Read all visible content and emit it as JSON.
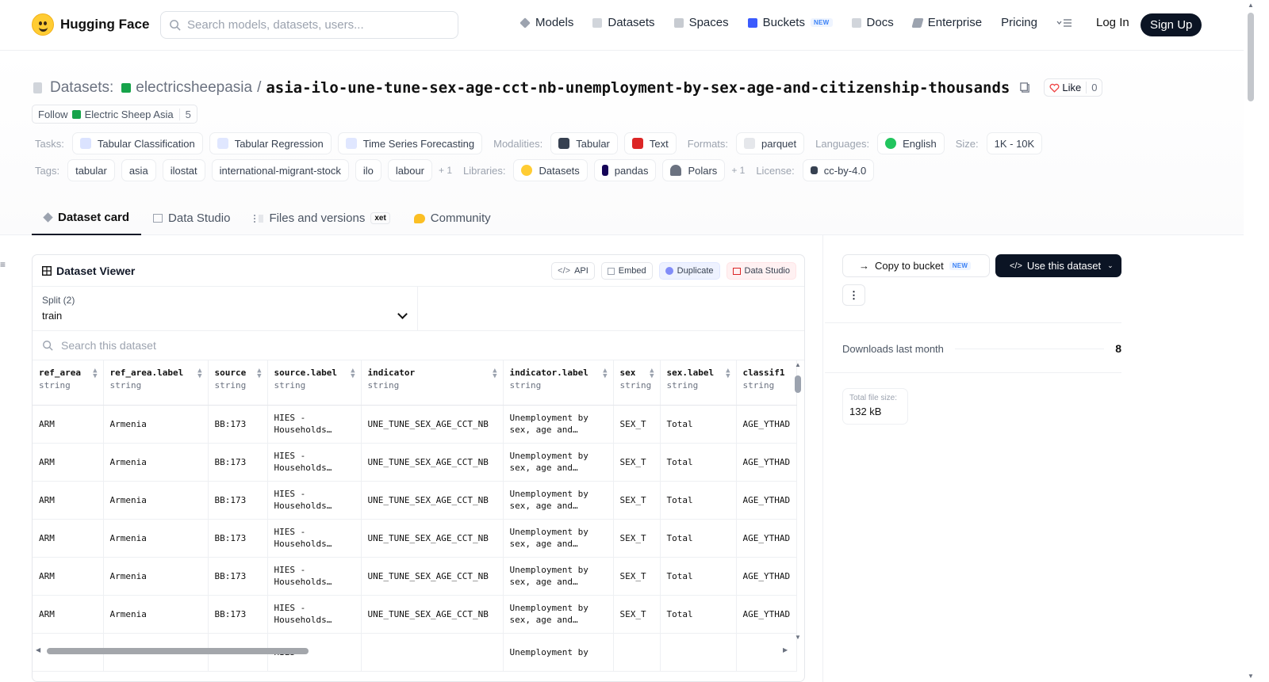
{
  "header": {
    "brand": "Hugging Face",
    "search_placeholder": "Search models, datasets, users...",
    "nav": [
      {
        "label": "Models",
        "icon": "cube-icon"
      },
      {
        "label": "Datasets",
        "icon": "database-icon"
      },
      {
        "label": "Spaces",
        "icon": "grid-icon"
      },
      {
        "label": "Buckets",
        "icon": "bucket-icon",
        "badge": "NEW"
      },
      {
        "label": "Docs",
        "icon": "book-icon"
      },
      {
        "label": "Enterprise",
        "icon": "building-icon"
      },
      {
        "label": "Pricing"
      }
    ],
    "login": "Log In",
    "signup": "Sign Up"
  },
  "dataset": {
    "prefix": "Datasets:",
    "owner": "electricsheepasia",
    "separator": "/",
    "name": "asia-ilo-une-tune-sex-age-cct-nb-unemployment-by-sex-age-and-citizenship-thousands",
    "like_label": "Like",
    "like_count": "0",
    "follow_label": "Follow",
    "follow_org": "Electric Sheep Asia",
    "follow_count": "5"
  },
  "meta": {
    "tasks_label": "Tasks:",
    "tasks": [
      "Tabular Classification",
      "Tabular Regression",
      "Time Series Forecasting"
    ],
    "modalities_label": "Modalities:",
    "modalities": [
      "Tabular",
      "Text"
    ],
    "formats_label": "Formats:",
    "formats": [
      "parquet"
    ],
    "languages_label": "Languages:",
    "languages": [
      "English"
    ],
    "size_label": "Size:",
    "size": "1K - 10K",
    "tags_label": "Tags:",
    "tags": [
      "tabular",
      "asia",
      "ilostat",
      "international-migrant-stock",
      "ilo",
      "labour"
    ],
    "tags_more": "+ 1",
    "libraries_label": "Libraries:",
    "libraries": [
      "Datasets",
      "pandas",
      "Polars"
    ],
    "libraries_more": "+ 1",
    "license_label": "License:",
    "license": "cc-by-4.0"
  },
  "tabs": [
    {
      "label": "Dataset card",
      "active": true
    },
    {
      "label": "Data Studio"
    },
    {
      "label": "Files and versions",
      "badge": "xet"
    },
    {
      "label": "Community"
    }
  ],
  "viewer": {
    "title": "Dataset Viewer",
    "buttons": [
      "API",
      "Embed",
      "Duplicate",
      "Data Studio"
    ],
    "split_label": "Split (2)",
    "split_value": "train",
    "search_placeholder": "Search this dataset",
    "columns": [
      {
        "name": "ref_area",
        "type": "string"
      },
      {
        "name": "ref_area.label",
        "type": "string"
      },
      {
        "name": "source",
        "type": "string"
      },
      {
        "name": "source.label",
        "type": "string"
      },
      {
        "name": "indicator",
        "type": "string"
      },
      {
        "name": "indicator.label",
        "type": "string"
      },
      {
        "name": "sex",
        "type": "string"
      },
      {
        "name": "sex.label",
        "type": "string"
      },
      {
        "name": "classif1",
        "type": "string"
      }
    ],
    "rows": [
      [
        "ARM",
        "Armenia",
        "BB:173",
        "HIES - Households…",
        "UNE_TUNE_SEX_AGE_CCT_NB",
        "Unemployment by sex, age and…",
        "SEX_T",
        "Total",
        "AGE_YTHAD"
      ],
      [
        "ARM",
        "Armenia",
        "BB:173",
        "HIES - Households…",
        "UNE_TUNE_SEX_AGE_CCT_NB",
        "Unemployment by sex, age and…",
        "SEX_T",
        "Total",
        "AGE_YTHAD"
      ],
      [
        "ARM",
        "Armenia",
        "BB:173",
        "HIES - Households…",
        "UNE_TUNE_SEX_AGE_CCT_NB",
        "Unemployment by sex, age and…",
        "SEX_T",
        "Total",
        "AGE_YTHAD"
      ],
      [
        "ARM",
        "Armenia",
        "BB:173",
        "HIES - Households…",
        "UNE_TUNE_SEX_AGE_CCT_NB",
        "Unemployment by sex, age and…",
        "SEX_T",
        "Total",
        "AGE_YTHAD"
      ],
      [
        "ARM",
        "Armenia",
        "BB:173",
        "HIES - Households…",
        "UNE_TUNE_SEX_AGE_CCT_NB",
        "Unemployment by sex, age and…",
        "SEX_T",
        "Total",
        "AGE_YTHAD"
      ],
      [
        "ARM",
        "Armenia",
        "BB:173",
        "HIES - Households…",
        "UNE_TUNE_SEX_AGE_CCT_NB",
        "Unemployment by sex, age and…",
        "SEX_T",
        "Total",
        "AGE_YTHAD"
      ],
      [
        "",
        "",
        "",
        "HIES -",
        "",
        "Unemployment by",
        "",
        "",
        ""
      ]
    ]
  },
  "sidebar": {
    "copy_label": "Copy to bucket",
    "copy_badge": "NEW",
    "use_label": "Use this dataset",
    "downloads_label": "Downloads last month",
    "downloads_value": "8",
    "filesize_label": "Total file size:",
    "filesize_value": "132 kB"
  },
  "colors": {
    "accent_dark": "#0b1424",
    "like_heart": "#ef4444"
  }
}
